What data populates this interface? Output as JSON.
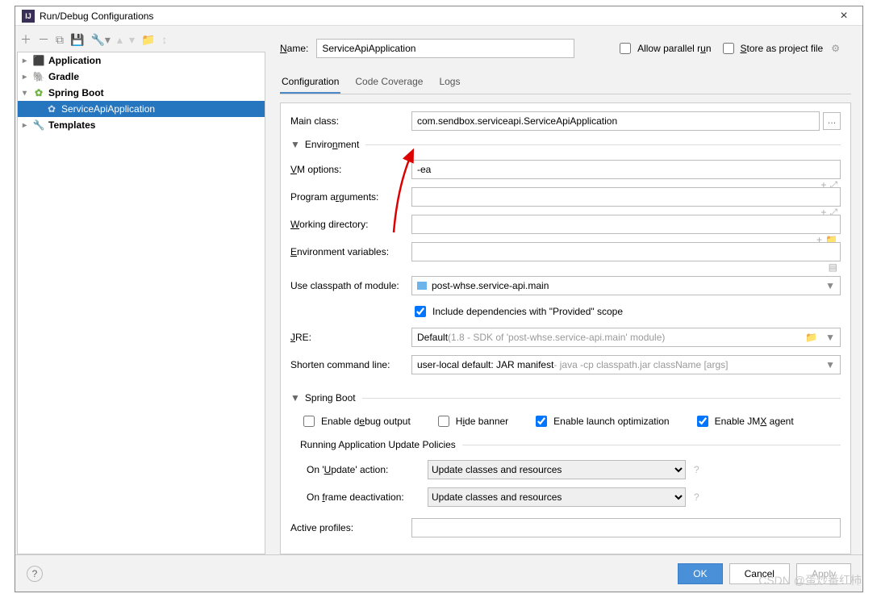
{
  "window": {
    "title": "Run/Debug Configurations"
  },
  "top": {
    "name_label": "Name:",
    "name_value": "ServiceApiApplication",
    "allow_parallel": "Allow parallel run",
    "store_as_project": "Store as project file"
  },
  "tree": {
    "items": [
      {
        "label": "Application",
        "bold": true
      },
      {
        "label": "Gradle",
        "bold": true
      },
      {
        "label": "Spring Boot",
        "bold": true,
        "expanded": true
      },
      {
        "label": "ServiceApiApplication",
        "child": true,
        "selected": true
      },
      {
        "label": "Templates",
        "bold": true
      }
    ]
  },
  "tabs": {
    "t1": "Configuration",
    "t2": "Code Coverage",
    "t3": "Logs"
  },
  "form": {
    "main_class_label": "Main class:",
    "main_class_value": "com.sendbox.serviceapi.ServiceApiApplication",
    "env_section": "Environment",
    "vm_label": "VM options:",
    "vm_value": "-ea",
    "args_label": "Program arguments:",
    "wd_label": "Working directory:",
    "envvars_label": "Environment variables:",
    "classpath_label": "Use classpath of module:",
    "classpath_value": "post-whse.service-api.main",
    "include_provided": "Include dependencies with \"Provided\" scope",
    "jre_label": "JRE:",
    "jre_value": "Default ",
    "jre_hint": "(1.8 - SDK of 'post-whse.service-api.main' module)",
    "shorten_label": "Shorten command line:",
    "shorten_value": "user-local default: JAR manifest ",
    "shorten_hint": "- java -cp classpath.jar className [args]",
    "spring_section": "Spring Boot",
    "enable_debug": "Enable debug output",
    "hide_banner": "Hide banner",
    "enable_launch": "Enable launch optimization",
    "enable_jmx": "Enable JMX agent",
    "update_policies": "Running Application Update Policies",
    "on_update_label": "On 'Update' action:",
    "on_update_value": "Update classes and resources",
    "on_frame_label": "On frame deactivation:",
    "on_frame_value": "Update classes and resources",
    "active_profiles": "Active profiles:"
  },
  "footer": {
    "ok": "OK",
    "cancel": "Cancel",
    "apply": "Apply"
  },
  "watermark": "CSDN @蛋炒番红柿"
}
